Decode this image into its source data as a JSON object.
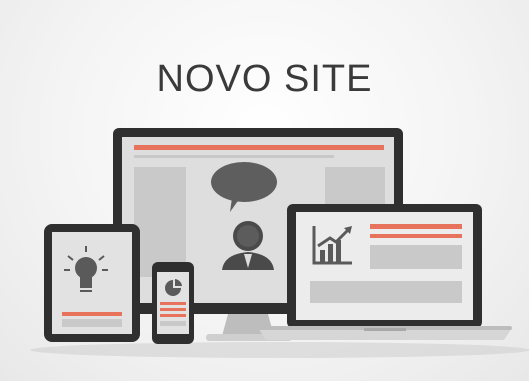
{
  "title": "NOVO SITE",
  "colors": {
    "accent": "#e8735c",
    "device_frame": "#2f2f2f",
    "screen_bg": "#dcdcdc",
    "panel": "#c9c9c9",
    "icon_dark": "#5a5a5a"
  },
  "devices": [
    {
      "name": "desktop-monitor",
      "icons": [
        "speech-bubble-icon",
        "user-icon"
      ]
    },
    {
      "name": "laptop",
      "icons": [
        "bar-chart-icon"
      ]
    },
    {
      "name": "tablet",
      "icons": [
        "lightbulb-icon"
      ]
    },
    {
      "name": "smartphone",
      "icons": [
        "pie-chart-icon"
      ]
    }
  ]
}
